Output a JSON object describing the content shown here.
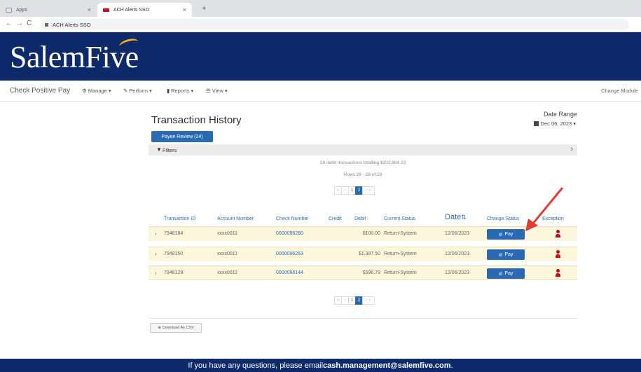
{
  "browser": {
    "tabs": [
      {
        "label": "Apps"
      },
      {
        "label": "ACH Alerts SSO"
      }
    ],
    "address": "ACH Alerts SSO"
  },
  "brand": {
    "logo_text": "SalemFive"
  },
  "menubar": {
    "app_name": "Check Positive Pay",
    "items": [
      {
        "icon": "gear-icon",
        "label": "Manage ▾"
      },
      {
        "icon": "pencil-icon",
        "label": "Perform ▾"
      },
      {
        "icon": "chart-icon",
        "label": "Reports ▾"
      },
      {
        "icon": "list-icon",
        "label": "View ▾"
      }
    ],
    "change_module": "Change Module"
  },
  "page": {
    "title": "Transaction History",
    "payee_review": "Payee Review (24)",
    "date_range_label": "Date Range",
    "date_range_value": "Dec 06, 2023 ▾",
    "filters_label": "Filters",
    "summary": "28 debit transactions totalling $101,884.33",
    "rows": "Rows 26 - 28 of 28",
    "pager": [
      "«",
      "‹",
      "1",
      "2",
      "› »"
    ],
    "pager_active": "2",
    "columns": {
      "transaction_id": "Transaction ID",
      "account_number": "Account Number",
      "check_number": "Check Number",
      "credit": "Credit",
      "debit": "Debit",
      "current_status": "Current Status",
      "date": "Date",
      "change_status": "Change Status",
      "exception": "Exception"
    },
    "transactions": [
      {
        "id": "7948184",
        "account": "xxxx0011",
        "check": "0000096260",
        "credit": "",
        "debit": "$100.00",
        "status": "Return-System",
        "date": "12/06/2023",
        "action": "Pay"
      },
      {
        "id": "7948150",
        "account": "xxxx0011",
        "check": "0000096263",
        "credit": "",
        "debit": "$1,387.50",
        "status": "Return-System",
        "date": "12/06/2023",
        "action": "Pay"
      },
      {
        "id": "7948128",
        "account": "xxxx0011",
        "check": "0000096144",
        "credit": "",
        "debit": "$596.79",
        "status": "Return-System",
        "date": "12/06/2023",
        "action": "Pay"
      }
    ],
    "download_csv": "Download As CSV"
  },
  "footer": {
    "text": "If you have any questions, please email ",
    "email": "cash.management@salemfive.com",
    "end": "."
  },
  "colors": {
    "brand_navy": "#0d2b6b",
    "accent_blue": "#2a6ab3",
    "row_highlight": "#fcf6dc",
    "annotation_red": "#e53935"
  }
}
